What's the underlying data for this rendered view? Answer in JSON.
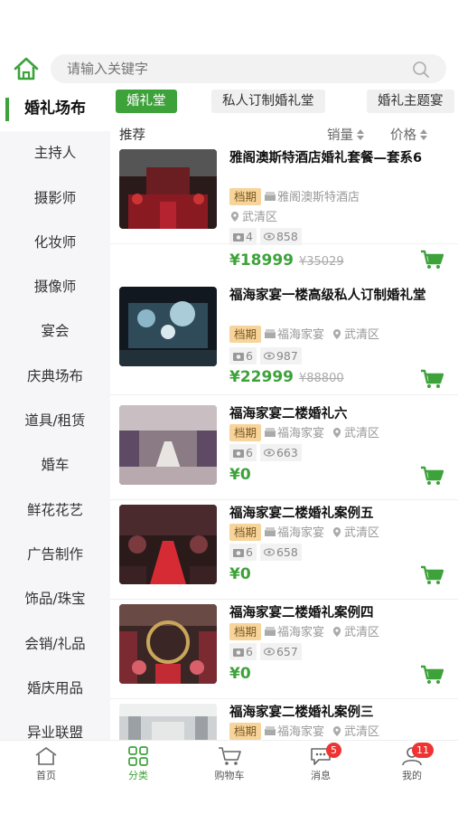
{
  "search": {
    "placeholder": "请输入关键字"
  },
  "sidebar": {
    "items": [
      {
        "label": "婚礼场布",
        "active": true
      },
      {
        "label": "主持人"
      },
      {
        "label": "摄影师"
      },
      {
        "label": "化妆师"
      },
      {
        "label": "摄像师"
      },
      {
        "label": "宴会"
      },
      {
        "label": "庆典场布"
      },
      {
        "label": "道具/租赁"
      },
      {
        "label": "婚车"
      },
      {
        "label": "鲜花花艺"
      },
      {
        "label": "广告制作"
      },
      {
        "label": "饰品/珠宝"
      },
      {
        "label": "会销/礼品"
      },
      {
        "label": "婚庆用品"
      },
      {
        "label": "异业联盟"
      }
    ]
  },
  "tabs": [
    {
      "label": "婚礼堂",
      "active": true
    },
    {
      "label": "私人订制婚礼堂"
    },
    {
      "label": "婚礼主题宴"
    }
  ],
  "sort": {
    "recommend": "推荐",
    "sales": "销量",
    "price": "价格"
  },
  "products": [
    {
      "title": "雅阁澳斯特酒店婚礼套餐—套系6",
      "badge": "档期",
      "venue": "雅阁澳斯特酒店",
      "district": "武清区",
      "photos": "4",
      "views": "858",
      "price": "¥18999",
      "old_price": "¥35029"
    },
    {
      "title": "福海家宴一楼高级私人订制婚礼堂",
      "badge": "档期",
      "venue": "福海家宴",
      "district": "武清区",
      "photos": "6",
      "views": "987",
      "price": "¥22999",
      "old_price": "¥88800"
    },
    {
      "title": "福海家宴二楼婚礼六",
      "badge": "档期",
      "venue": "福海家宴",
      "district": "武清区",
      "photos": "6",
      "views": "663",
      "price": "¥0",
      "old_price": ""
    },
    {
      "title": "福海家宴二楼婚礼案例五",
      "badge": "档期",
      "venue": "福海家宴",
      "district": "武清区",
      "photos": "6",
      "views": "658",
      "price": "¥0",
      "old_price": ""
    },
    {
      "title": "福海家宴二楼婚礼案例四",
      "badge": "档期",
      "venue": "福海家宴",
      "district": "武清区",
      "photos": "6",
      "views": "657",
      "price": "¥0",
      "old_price": ""
    },
    {
      "title": "福海家宴二楼婚礼案例三",
      "badge": "档期",
      "venue": "福海家宴",
      "district": "武清区",
      "photos": "",
      "views": "",
      "price": "",
      "old_price": ""
    }
  ],
  "bottom_nav": [
    {
      "label": "首页",
      "icon": "home-icon"
    },
    {
      "label": "分类",
      "icon": "category-icon",
      "active": true
    },
    {
      "label": "购物车",
      "icon": "cart-icon"
    },
    {
      "label": "消息",
      "icon": "message-icon",
      "badge": "5"
    },
    {
      "label": "我的",
      "icon": "user-icon",
      "badge": "11"
    }
  ],
  "colors": {
    "accent": "#3da23a",
    "badge_bg": "#f7d49c",
    "notify": "#e33333"
  }
}
